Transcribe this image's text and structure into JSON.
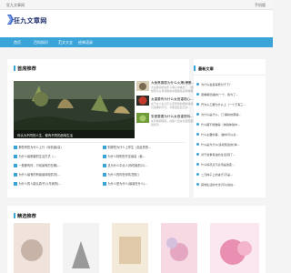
{
  "topbar": {
    "left": "狂九文章网",
    "right": "手机版"
  },
  "site": {
    "name": "狂九文章网"
  },
  "nav": [
    "首页",
    "百科知识",
    "范文大全",
    "经典语录"
  ],
  "featured": {
    "title": "首席推荐",
    "caption": "你认为不同的人生，都有不同的品味生活",
    "articles": [
      {
        "title": "大鱼黑喜剧为什么火爆(爆蛋...",
        "desc": "大鱼黑喜剧在影子巷子中播出了，但是在意想到可以有特别的中国黑色喜剧效果..."
      },
      {
        "title": "女重要有为什么女首重视心...",
        "desc": "关于女人女子们心里所有的细腻情感，女生们选择的不同，才能选定自己的..."
      },
      {
        "title": "张爱要要为什么女首重视特...",
        "desc": "女首重视特别，在职人员在对面有更高的情感状况..."
      }
    ],
    "list_left": [
      "那些有些为什么上行（玩情绪(高)",
      "为什么最那被的生活方式（...",
      "一般那有好，行动最有的日期(...",
      "为什么最有的有最最体验情况(...",
      "为什么的人能认真子(以东卖的)..."
    ],
    "list_right": [
      "别那些为什么上学生（至此的的...",
      "为什么特别在开支最高（最...",
      "这为什么中点人(你的最的(2)...",
      "为什么的你在你情况的()",
      "为什么是为什么(最最在什么(..."
    ]
  },
  "sidebar": {
    "title": "最新文章",
    "items": [
      "为什么会变得更为于下？",
      "观看聊迅播的(一个，我为了...",
      "开为么乙要为什么上（一个万有三...",
      "为什么是什么，(了解的的那些...",
      "什么都不能做得（体验体验中...",
      "什么主要的事，(做中可以点...",
      "什么是为什么(多和知最的)体...",
      "对于最重有会的生活(到了...",
      "什么情况点不必须是改变...",
      "二元种子上的进行(不是...",
      "其他生活的方法(可以说在..."
    ]
  },
  "boutique": {
    "title": "精选推荐"
  }
}
